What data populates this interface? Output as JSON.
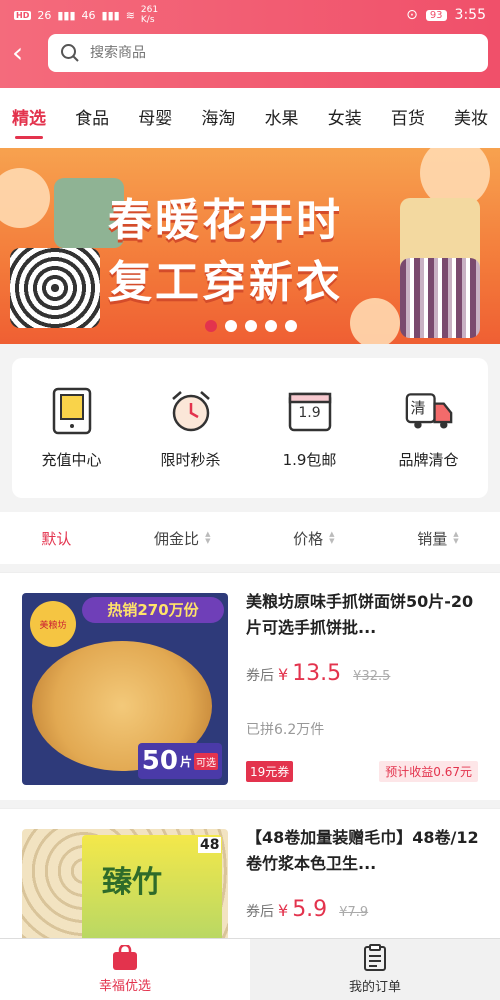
{
  "status": {
    "time": "3:55",
    "battery": "93",
    "hd": "HD",
    "net1": "26",
    "net2": "46",
    "speed": "261 K/s"
  },
  "search": {
    "placeholder": "搜索商品"
  },
  "categories": [
    "精选",
    "食品",
    "母婴",
    "海淘",
    "水果",
    "女装",
    "百货",
    "美妆"
  ],
  "banner": {
    "line1": "春暖花开时",
    "line2": "复工穿新衣",
    "dots": 5,
    "active_dot": 0
  },
  "quick_links": [
    {
      "label": "充值中心",
      "icon": "tablet-icon"
    },
    {
      "label": "限时秒杀",
      "icon": "alarm-clock-icon"
    },
    {
      "label": "1.9包邮",
      "icon": "calendar-icon",
      "badge": "1.9"
    },
    {
      "label": "品牌清仓",
      "icon": "truck-icon",
      "badge": "清"
    }
  ],
  "sort": [
    "默认",
    "佣金比",
    "价格",
    "销量"
  ],
  "products": [
    {
      "title": "美粮坊原味手抓饼面饼50片-20片可选手抓饼批...",
      "price_label": "券后",
      "currency": "¥",
      "price": "13.5",
      "orig_price": "¥32.5",
      "sold": "已拼6.2万件",
      "coupon": "19元券",
      "earn": "预计收益0.67元",
      "img_hot": "热销270万份",
      "img_brand": "美粮坊",
      "img_qty": "50",
      "img_unit": "片",
      "img_opt": "可选"
    },
    {
      "title": "【48卷加量装赠毛巾】48卷/12卷竹浆本色卫生...",
      "price_label": "券后",
      "currency": "¥",
      "price": "5.9",
      "orig_price": "¥7.9",
      "img_brand": "臻竹",
      "img_qty": "48"
    }
  ],
  "tabbar": [
    {
      "label": "幸福优选"
    },
    {
      "label": "我的订单"
    }
  ],
  "colors": {
    "accent": "#e3334d",
    "header": "#f0506a"
  }
}
